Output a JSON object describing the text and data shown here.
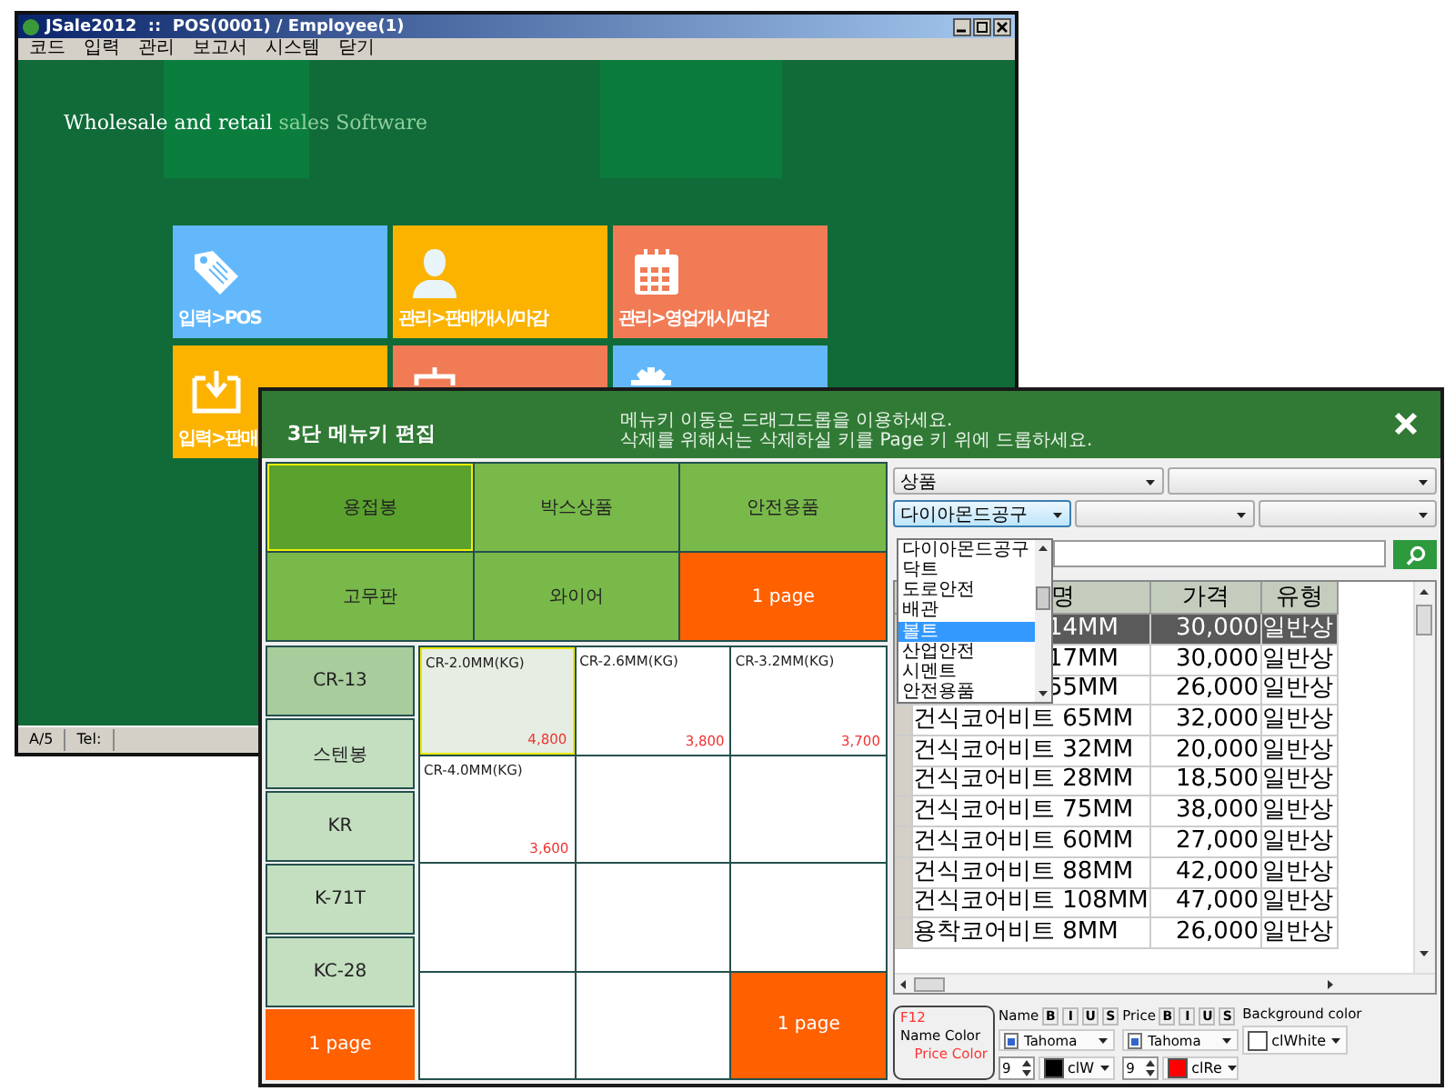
{
  "back_window": {
    "title": "JSale2012  ::  POS(0001) / Employee(1)",
    "menu": [
      "코드",
      "입력",
      "관리",
      "보고서",
      "시스템",
      "닫기"
    ],
    "tagline": {
      "text": "Wholesale and retail",
      "accent": "sales Software"
    },
    "tiles": [
      {
        "label": "입력>POS",
        "color": "#62b8fb"
      },
      {
        "label": "관리>판매개시/마감",
        "color": "#fbb300"
      },
      {
        "label": "관리>영업개시/마감",
        "color": "#f07b55"
      },
      {
        "label": "입력>판매",
        "color": "#fbb300"
      },
      {
        "color": "#f07b55"
      },
      {
        "color": "#62b8fb"
      }
    ],
    "status_bar": [
      "A/5",
      "Tel:"
    ]
  },
  "dialog": {
    "title": "3단 메뉴키 편집",
    "instructions": [
      "메뉴키 이동은 드래그드롭을 이용하세요.",
      "삭제를 위해서는 삭제하실 키를 Page 키 위에 드롭하세요."
    ],
    "top_keys": [
      {
        "kind": "key",
        "label": "용접봉",
        "selected": true
      },
      {
        "kind": "key",
        "label": "박스상품",
        "selected": false
      },
      {
        "kind": "key",
        "label": "안전용품",
        "selected": false
      },
      {
        "kind": "key",
        "label": "고무판",
        "selected": false
      },
      {
        "kind": "key",
        "label": "와이어",
        "selected": false
      },
      {
        "kind": "page",
        "label": "1 page"
      }
    ],
    "side_keys": [
      {
        "kind": "key",
        "label": "CR-13",
        "selected": true
      },
      {
        "kind": "key",
        "label": "스텐봉",
        "selected": false
      },
      {
        "kind": "key",
        "label": "KR",
        "selected": false
      },
      {
        "kind": "key",
        "label": "K-71T",
        "selected": false
      },
      {
        "kind": "key",
        "label": "KC-28",
        "selected": false
      },
      {
        "kind": "page",
        "label": "1 page"
      }
    ],
    "item_keys": [
      {
        "kind": "item",
        "name": "CR-2.0MM(KG)",
        "price": "4,800",
        "selected": true
      },
      {
        "kind": "item",
        "name": "CR-2.6MM(KG)",
        "price": "3,800",
        "selected": false
      },
      {
        "kind": "item",
        "name": "CR-3.2MM(KG)",
        "price": "3,700",
        "selected": false
      },
      {
        "kind": "item",
        "name": "CR-4.0MM(KG)",
        "price": "3,600",
        "selected": false
      },
      {
        "kind": "empty"
      },
      {
        "kind": "empty"
      },
      {
        "kind": "empty"
      },
      {
        "kind": "empty"
      },
      {
        "kind": "empty"
      },
      {
        "kind": "empty"
      },
      {
        "kind": "empty"
      },
      {
        "kind": "page",
        "label": "1 page"
      }
    ],
    "filters": [
      [
        {
          "kind": "combo",
          "value": "상품",
          "focused": false
        },
        {
          "kind": "combo",
          "focused": false
        }
      ],
      [
        {
          "kind": "combo",
          "value": "다이아몬드공구",
          "focused": true
        },
        {
          "kind": "combo",
          "focused": false
        },
        {
          "kind": "combo",
          "focused": false
        }
      ]
    ],
    "dropdown": {
      "items": [
        {
          "label": "다이아몬드공구",
          "selected": false
        },
        {
          "label": "닥트",
          "selected": false
        },
        {
          "label": "도로안전",
          "selected": false
        },
        {
          "label": "배관",
          "selected": false
        },
        {
          "label": "볼트",
          "selected": true
        },
        {
          "label": "산업안전",
          "selected": false
        },
        {
          "label": "시멘트",
          "selected": false
        },
        {
          "label": "안전용품",
          "selected": false
        }
      ]
    },
    "table": {
      "columns": [
        {
          "label": "명",
          "covered": true
        },
        {
          "label": "가격",
          "covered": false
        },
        {
          "label": "유형",
          "covered": false
        }
      ],
      "rows": [
        {
          "selected": true,
          "covered": true,
          "cells": [
            "14MM",
            "30,000",
            "일반상"
          ]
        },
        {
          "selected": false,
          "covered": true,
          "cells": [
            "17MM",
            "30,000",
            "일반상"
          ]
        },
        {
          "selected": false,
          "covered": true,
          "cells": [
            "55MM",
            "26,000",
            "일반상"
          ]
        },
        {
          "selected": false,
          "covered": false,
          "cells": [
            "건식코어비트 65MM",
            "32,000",
            "일반상"
          ]
        },
        {
          "selected": false,
          "covered": false,
          "cells": [
            "건식코어비트 32MM",
            "20,000",
            "일반상"
          ]
        },
        {
          "selected": false,
          "covered": false,
          "cells": [
            "건식코어비트 28MM",
            "18,500",
            "일반상"
          ]
        },
        {
          "selected": false,
          "covered": false,
          "cells": [
            "건식코어비트 75MM",
            "38,000",
            "일반상"
          ]
        },
        {
          "selected": false,
          "covered": false,
          "cells": [
            "건식코어비트 60MM",
            "27,000",
            "일반상"
          ]
        },
        {
          "selected": false,
          "covered": false,
          "cells": [
            "건식코어비트 88MM",
            "42,000",
            "일반상"
          ]
        },
        {
          "selected": false,
          "covered": false,
          "cells": [
            "건식코어비트 108MM",
            "47,000",
            "일반상"
          ]
        },
        {
          "selected": false,
          "covered": false,
          "cells": [
            "용착코어비트 8MM",
            "26,000",
            "일반상"
          ]
        }
      ]
    },
    "format_bar": {
      "hint": {
        "key": "F12",
        "name": "Name Color",
        "price": "Price Color"
      },
      "groups": [
        {
          "label": "Name",
          "styles": [
            "B",
            "I",
            "U",
            "S"
          ],
          "font": "Tahoma",
          "size": "9",
          "color_name": "clW",
          "color": "#000000"
        },
        {
          "label": "Price",
          "styles": [
            "B",
            "I",
            "U",
            "S"
          ],
          "font": "Tahoma",
          "size": "9",
          "color_name": "clRe",
          "color": "#ff0000"
        }
      ],
      "background": {
        "label": "Background color",
        "color_name": "clWhite",
        "color": "#ffffff"
      }
    }
  }
}
